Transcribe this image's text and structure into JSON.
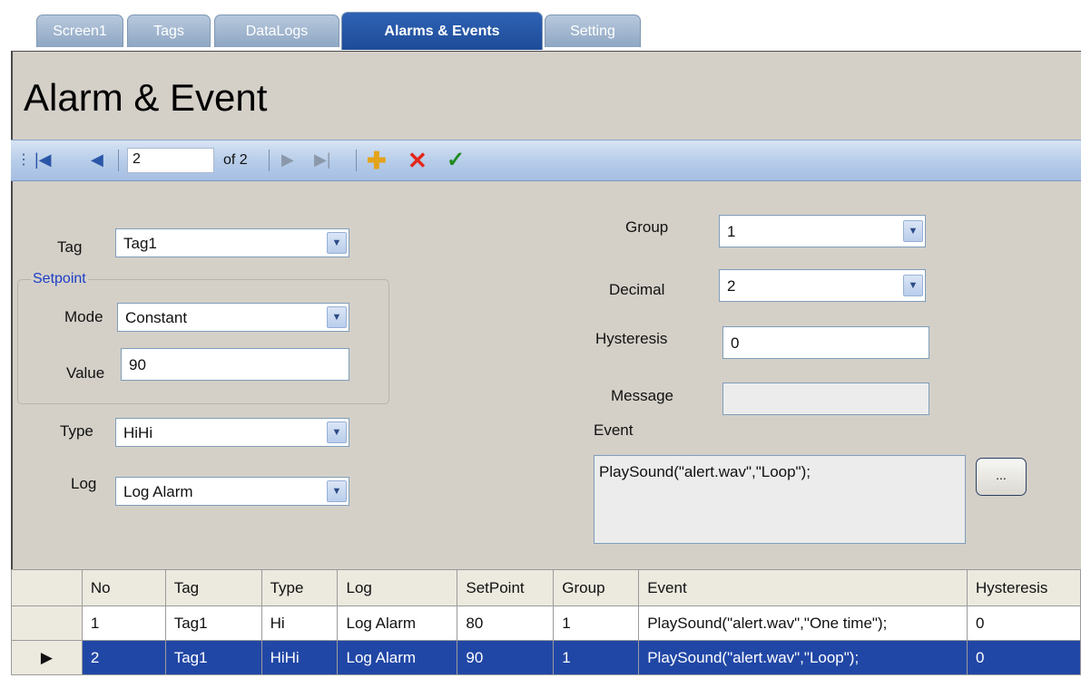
{
  "tabs": [
    "Screen1",
    "Tags",
    "DataLogs",
    "Alarms & Events",
    "Setting"
  ],
  "active_tab": "Alarms & Events",
  "page_title": "Alarm & Event",
  "navigator": {
    "position": "2",
    "of_count": "of 2",
    "icons": [
      "move-first-icon",
      "move-previous-icon",
      "move-next-icon",
      "move-last-icon",
      "add-icon",
      "delete-icon",
      "save-check-icon"
    ]
  },
  "form": {
    "tag_label": "Tag",
    "tag_value": "Tag1",
    "setpoint_legend": "Setpoint",
    "mode_label": "Mode",
    "mode_value": "Constant",
    "value_label": "Value",
    "value_value": "90",
    "type_label": "Type",
    "type_value": "HiHi",
    "log_label": "Log",
    "log_value": "Log Alarm",
    "group_label": "Group",
    "group_value": "1",
    "decimal_label": "Decimal",
    "decimal_value": "2",
    "hysteresis_label": "Hysteresis",
    "hysteresis_value": "0",
    "message_label": "Message",
    "message_value": "",
    "event_label": "Event",
    "event_value": "PlaySound(\"alert.wav\",\"Loop\");",
    "browse_label": "..."
  },
  "grid": {
    "columns": [
      "No",
      "Tag",
      "Type",
      "Log",
      "SetPoint",
      "Group",
      "Event",
      "Hysteresis"
    ],
    "rows": [
      [
        "1",
        "Tag1",
        "Hi",
        "Log Alarm",
        "80",
        "1",
        "PlaySound(\"alert.wav\",\"One time\");",
        "0"
      ],
      [
        "2",
        "Tag1",
        "HiHi",
        "Log Alarm",
        "90",
        "1",
        "PlaySound(\"alert.wav\",\"Loop\");",
        "0"
      ]
    ],
    "selected_row": 2,
    "current_row_marker": "▶"
  },
  "colors": {
    "active_tab": "#2559ad",
    "panel": "#d4d0c8",
    "selected_row": "#2147a6",
    "legend_text": "#1c3dc7"
  }
}
